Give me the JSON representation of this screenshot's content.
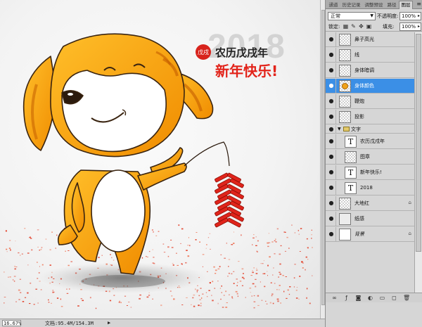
{
  "canvas": {
    "title_year": "2018",
    "line1": "农历戊戌年",
    "line2": "新年快乐!",
    "seal_text": "戊戌"
  },
  "status": {
    "zoom": "16.67%",
    "doc_info": "文档:95.4M/154.3M",
    "arrow": "▶"
  },
  "panel": {
    "tabs": [
      {
        "label": "通道"
      },
      {
        "label": "历史记录"
      },
      {
        "label": "调整预设"
      },
      {
        "label": "路径"
      },
      {
        "label": "图层"
      }
    ],
    "blend_mode": "正常",
    "opacity_label": "不透明度:",
    "opacity_value": "100%",
    "lock_label": "锁定:",
    "fill_label": "填充:",
    "fill_value": "100%",
    "menu_icon": "≡",
    "layers": [
      {
        "name": "鼻子高光",
        "kind": "pixel"
      },
      {
        "name": "线",
        "kind": "pixel"
      },
      {
        "name": "身体暗调",
        "kind": "pixel"
      },
      {
        "name": "身体颜色",
        "kind": "dog",
        "selected": true
      },
      {
        "name": "鞭炮",
        "kind": "pixel"
      },
      {
        "name": "投影",
        "kind": "pixel"
      },
      {
        "name": "文字",
        "kind": "group"
      },
      {
        "name": "农历戊戌年",
        "kind": "text",
        "indent": true
      },
      {
        "name": "图章",
        "kind": "pixel",
        "indent": true
      },
      {
        "name": "新年快乐!",
        "kind": "text",
        "indent": true
      },
      {
        "name": "2018",
        "kind": "text",
        "indent": true
      },
      {
        "name": "大地红",
        "kind": "pixel",
        "lock": true
      },
      {
        "name": "纸感",
        "kind": "paper"
      },
      {
        "name": "背景",
        "kind": "plain",
        "lock": true
      }
    ],
    "text_thumb_glyph": "T",
    "eye_glyph": "●",
    "lock_glyph": "🔒"
  }
}
